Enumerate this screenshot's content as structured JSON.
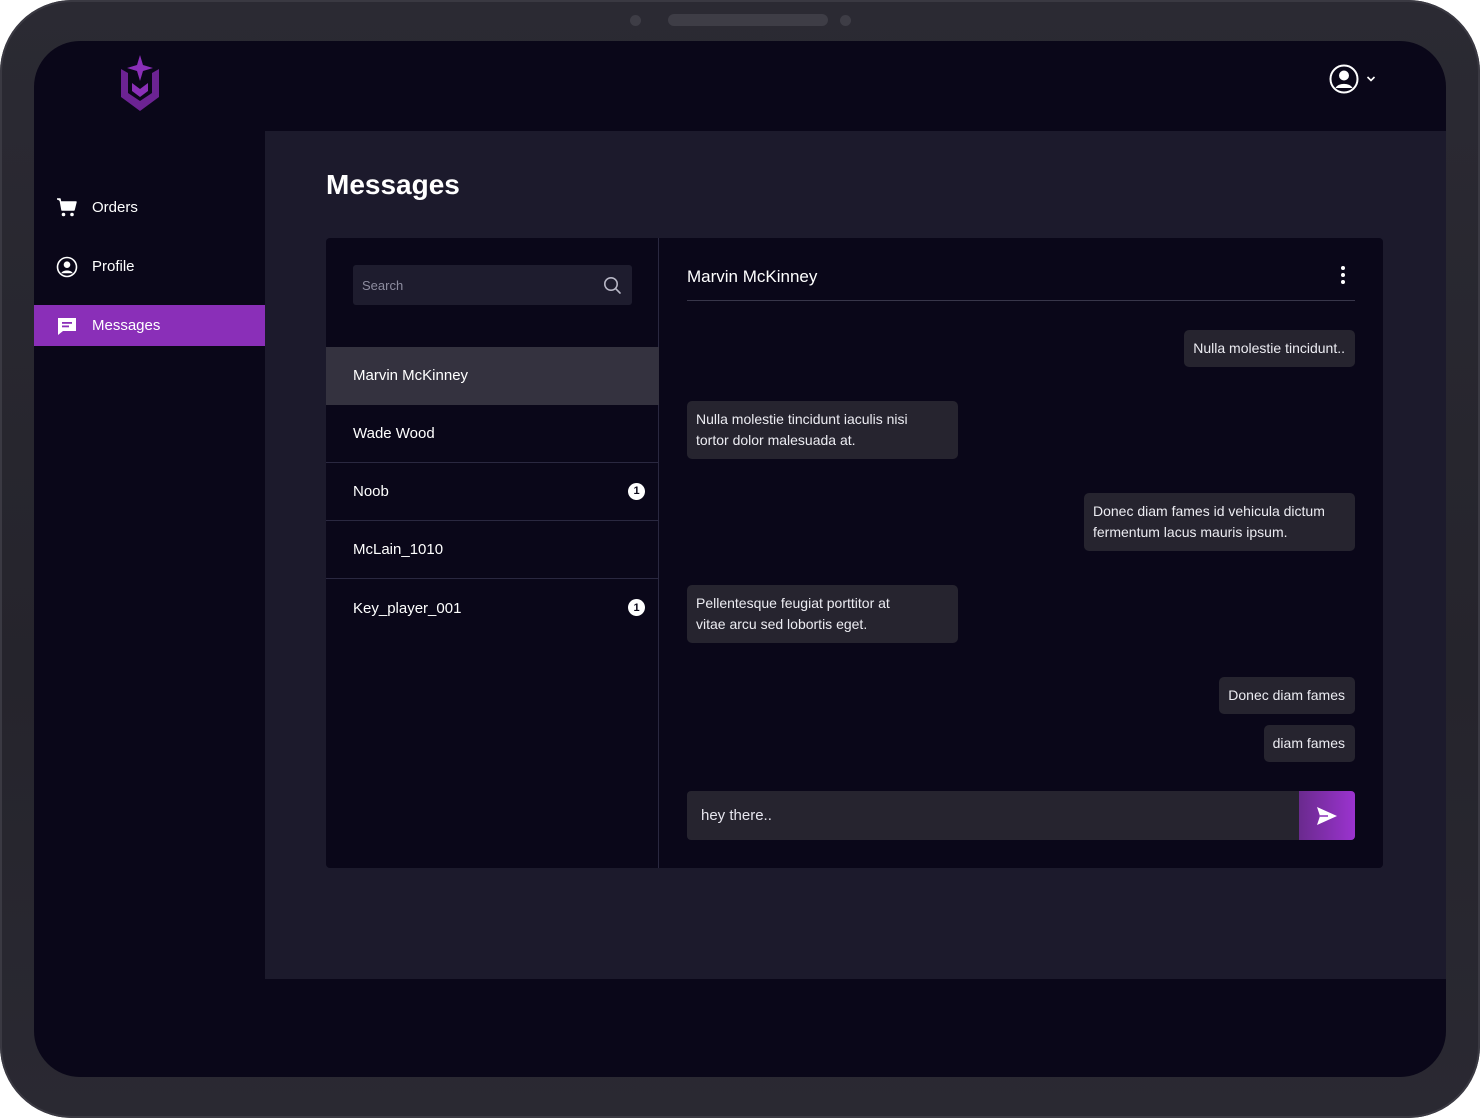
{
  "app": {
    "accent_color": "#8a2fb8",
    "logo_icon": "shield-crown-logo"
  },
  "header": {
    "user_icon": "user-circle-icon",
    "dropdown_icon": "chevron-down-icon"
  },
  "sidebar": {
    "items": [
      {
        "label": "Orders",
        "icon": "cart-icon",
        "active": false
      },
      {
        "label": "Profile",
        "icon": "user-circle-icon",
        "active": false
      },
      {
        "label": "Messages",
        "icon": "chat-bubble-icon",
        "active": true
      }
    ]
  },
  "main": {
    "title": "Messages"
  },
  "contacts": {
    "search_placeholder": "Search",
    "items": [
      {
        "name": "Marvin McKinney",
        "selected": true,
        "unread": null
      },
      {
        "name": "Wade Wood",
        "selected": false,
        "unread": null
      },
      {
        "name": "Noob",
        "selected": false,
        "unread": "1"
      },
      {
        "name": "McLain_1010",
        "selected": false,
        "unread": null
      },
      {
        "name": "Key_player_001",
        "selected": false,
        "unread": "1"
      }
    ]
  },
  "chat": {
    "contact_name": "Marvin McKinney",
    "messages": [
      {
        "direction": "outgoing",
        "text": "Nulla molestie tincidunt.."
      },
      {
        "direction": "incoming",
        "text": "Nulla molestie tincidunt iaculis nisi\ntortor dolor malesuada at."
      },
      {
        "direction": "outgoing",
        "text": "Donec diam fames id vehicula dictum\nfermentum lacus mauris ipsum."
      },
      {
        "direction": "incoming",
        "text": "Pellentesque feugiat porttitor at\nvitae arcu sed lobortis eget."
      },
      {
        "direction": "outgoing",
        "text": "Donec diam fames"
      },
      {
        "direction": "outgoing",
        "text": "diam fames"
      }
    ],
    "composer_value": "hey there.."
  }
}
